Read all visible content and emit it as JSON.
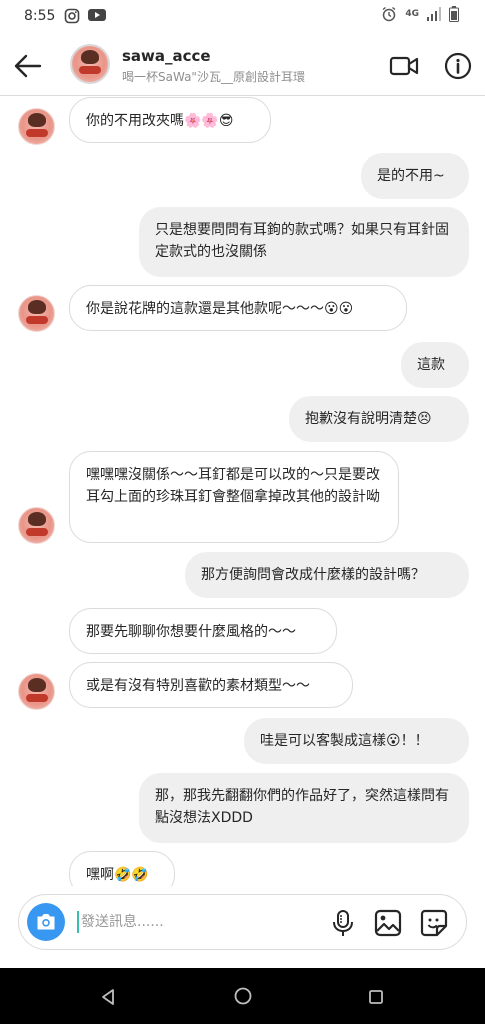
{
  "status": {
    "time": "8:55",
    "network": "4G"
  },
  "header": {
    "name": "sawa_acce",
    "subtitle": "喝一杯SaWa\"沙瓦__原創設計耳環"
  },
  "messages": [
    {
      "side": "in",
      "text": "你的不用改夾嗎🌸🌸😎"
    },
    {
      "side": "out",
      "text": "是的不用~"
    },
    {
      "side": "out",
      "text": "只是想要問問有耳鉤的款式嗎？如果只有耳針固定款式的也沒關係"
    },
    {
      "side": "in",
      "text": "你是說花牌的這款還是其他款呢～～～😮😮"
    },
    {
      "side": "out",
      "text": "這款"
    },
    {
      "side": "out",
      "text": "抱歉沒有說明清楚😣"
    },
    {
      "side": "in",
      "text": "嘿嘿嘿沒關係～～耳釘都是可以改的～只是要改耳勾上面的珍珠耳釘會整個拿掉改其他的設計呦"
    },
    {
      "side": "out",
      "text": "那方便詢問會改成什麼樣的設計嗎？"
    },
    {
      "side": "in",
      "text": "那要先聊聊你想要什麼風格的～～"
    },
    {
      "side": "in",
      "text": "或是有沒有特別喜歡的素材類型～～"
    },
    {
      "side": "out",
      "text": "哇是可以客製成這樣😮！！"
    },
    {
      "side": "out",
      "text": "那，那我先翻翻你們的作品好了，突然這樣問有點沒想法XDDD"
    },
    {
      "side": "in",
      "text": "嘿啊🤣🤣"
    }
  ],
  "composer": {
    "placeholder": "發送訊息......"
  }
}
